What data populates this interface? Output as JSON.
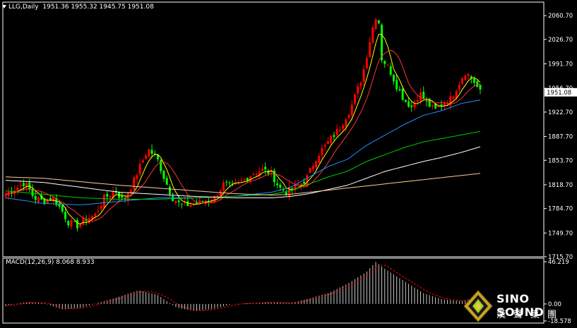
{
  "header": {
    "symbol": "LLG,Daily",
    "ohlc": "1951.36 1955.32 1945.75 1951.08"
  },
  "macd": {
    "label": "MACD(12,26,9) 8.068 8.933",
    "ylim": [
      -18.578,
      46.219
    ],
    "axis_top": "46.219",
    "axis_mid": "0.00",
    "axis_bottom": "-18.578"
  },
  "price_label": "1951.08",
  "colors": {
    "up": "#ff0000",
    "down": "#00ff00",
    "ma5": "#ffff00",
    "ma10": "#ff3333",
    "ma20": "#1e90ff",
    "ma30": "#00cc00",
    "ma60": "#ffffff",
    "ma120": "#ffcc99",
    "macd_hist": "#c8c8c8",
    "macd_signal": "#ff0000"
  },
  "logo": {
    "name": "SINO SOUND",
    "chinese": "漢聲集團"
  },
  "chart_data": {
    "type": "candlestick",
    "ylim": [
      1715.7,
      2075
    ],
    "yticks": [
      "2060.70",
      "2026.70",
      "1991.70",
      "1956.70",
      "1922.70",
      "1887.70",
      "1853.70",
      "1818.70",
      "1784.70",
      "1749.70",
      "1715.70"
    ],
    "bar_count": 160,
    "close_anchors": [
      [
        0,
        1805
      ],
      [
        6,
        1815
      ],
      [
        10,
        1822
      ],
      [
        15,
        1800
      ],
      [
        20,
        1795
      ],
      [
        25,
        1800
      ],
      [
        30,
        1780
      ],
      [
        33,
        1765
      ],
      [
        38,
        1760
      ],
      [
        42,
        1770
      ],
      [
        47,
        1775
      ],
      [
        52,
        1800
      ],
      [
        58,
        1810
      ],
      [
        62,
        1795
      ],
      [
        66,
        1815
      ],
      [
        70,
        1840
      ],
      [
        75,
        1870
      ],
      [
        80,
        1855
      ],
      [
        84,
        1825
      ],
      [
        88,
        1800
      ],
      [
        92,
        1790
      ],
      [
        98,
        1790
      ],
      [
        104,
        1795
      ],
      [
        110,
        1800
      ],
      [
        115,
        1820
      ],
      [
        120,
        1815
      ],
      [
        125,
        1825
      ],
      [
        130,
        1835
      ],
      [
        135,
        1840
      ],
      [
        140,
        1835
      ],
      [
        144,
        1815
      ],
      [
        148,
        1808
      ],
      [
        152,
        1815
      ],
      [
        158,
        1825
      ],
      [
        164,
        1860
      ],
      [
        170,
        1880
      ],
      [
        176,
        1900
      ],
      [
        182,
        1930
      ],
      [
        188,
        1975
      ],
      [
        193,
        2040
      ],
      [
        196,
        2070
      ],
      [
        198,
        2000
      ],
      [
        202,
        1985
      ],
      [
        206,
        1960
      ],
      [
        210,
        1940
      ],
      [
        214,
        1930
      ],
      [
        218,
        1950
      ],
      [
        222,
        1935
      ],
      [
        226,
        1925
      ],
      [
        230,
        1935
      ],
      [
        234,
        1940
      ],
      [
        238,
        1960
      ],
      [
        242,
        1980
      ],
      [
        246,
        1970
      ],
      [
        250,
        1951
      ]
    ],
    "lines": {
      "ma20_anchors": [
        [
          0,
          1800
        ],
        [
          20,
          1792
        ],
        [
          40,
          1790
        ],
        [
          60,
          1795
        ],
        [
          80,
          1800
        ],
        [
          100,
          1800
        ],
        [
          120,
          1802
        ],
        [
          140,
          1808
        ],
        [
          150,
          1815
        ],
        [
          160,
          1830
        ],
        [
          170,
          1845
        ],
        [
          180,
          1855
        ],
        [
          190,
          1875
        ],
        [
          200,
          1890
        ],
        [
          210,
          1905
        ],
        [
          220,
          1918
        ],
        [
          230,
          1925
        ],
        [
          240,
          1935
        ],
        [
          250,
          1940
        ]
      ],
      "ma30_anchors": [
        [
          0,
          1810
        ],
        [
          20,
          1805
        ],
        [
          40,
          1800
        ],
        [
          60,
          1798
        ],
        [
          80,
          1798
        ],
        [
          100,
          1800
        ],
        [
          120,
          1802
        ],
        [
          140,
          1805
        ],
        [
          150,
          1810
        ],
        [
          160,
          1820
        ],
        [
          170,
          1830
        ],
        [
          180,
          1838
        ],
        [
          190,
          1852
        ],
        [
          200,
          1862
        ],
        [
          210,
          1872
        ],
        [
          220,
          1880
        ],
        [
          230,
          1885
        ],
        [
          240,
          1890
        ],
        [
          250,
          1895
        ]
      ],
      "ma60_anchors": [
        [
          0,
          1825
        ],
        [
          20,
          1822
        ],
        [
          40,
          1815
        ],
        [
          60,
          1808
        ],
        [
          80,
          1805
        ],
        [
          100,
          1802
        ],
        [
          120,
          1800
        ],
        [
          140,
          1800
        ],
        [
          150,
          1802
        ],
        [
          160,
          1806
        ],
        [
          170,
          1812
        ],
        [
          180,
          1818
        ],
        [
          190,
          1828
        ],
        [
          200,
          1838
        ],
        [
          210,
          1845
        ],
        [
          220,
          1852
        ],
        [
          230,
          1858
        ],
        [
          240,
          1865
        ],
        [
          250,
          1873
        ]
      ],
      "ma120_anchors": [
        [
          0,
          1830
        ],
        [
          20,
          1828
        ],
        [
          40,
          1823
        ],
        [
          60,
          1818
        ],
        [
          80,
          1814
        ],
        [
          100,
          1810
        ],
        [
          120,
          1806
        ],
        [
          140,
          1804
        ],
        [
          150,
          1805
        ],
        [
          160,
          1808
        ],
        [
          170,
          1811
        ],
        [
          180,
          1814
        ],
        [
          190,
          1817
        ],
        [
          200,
          1820
        ],
        [
          210,
          1823
        ],
        [
          220,
          1826
        ],
        [
          230,
          1829
        ],
        [
          240,
          1832
        ],
        [
          250,
          1835
        ]
      ]
    },
    "macd_anchors": [
      [
        0,
        -2
      ],
      [
        10,
        2
      ],
      [
        20,
        1
      ],
      [
        30,
        -6
      ],
      [
        40,
        -4
      ],
      [
        50,
        2
      ],
      [
        60,
        8
      ],
      [
        70,
        15
      ],
      [
        80,
        10
      ],
      [
        90,
        -4
      ],
      [
        100,
        -8
      ],
      [
        110,
        -5
      ],
      [
        120,
        0
      ],
      [
        130,
        1
      ],
      [
        140,
        2
      ],
      [
        150,
        1
      ],
      [
        160,
        6
      ],
      [
        170,
        12
      ],
      [
        180,
        22
      ],
      [
        190,
        35
      ],
      [
        195,
        46
      ],
      [
        200,
        38
      ],
      [
        210,
        25
      ],
      [
        220,
        12
      ],
      [
        230,
        5
      ],
      [
        240,
        3
      ],
      [
        250,
        8
      ]
    ]
  }
}
